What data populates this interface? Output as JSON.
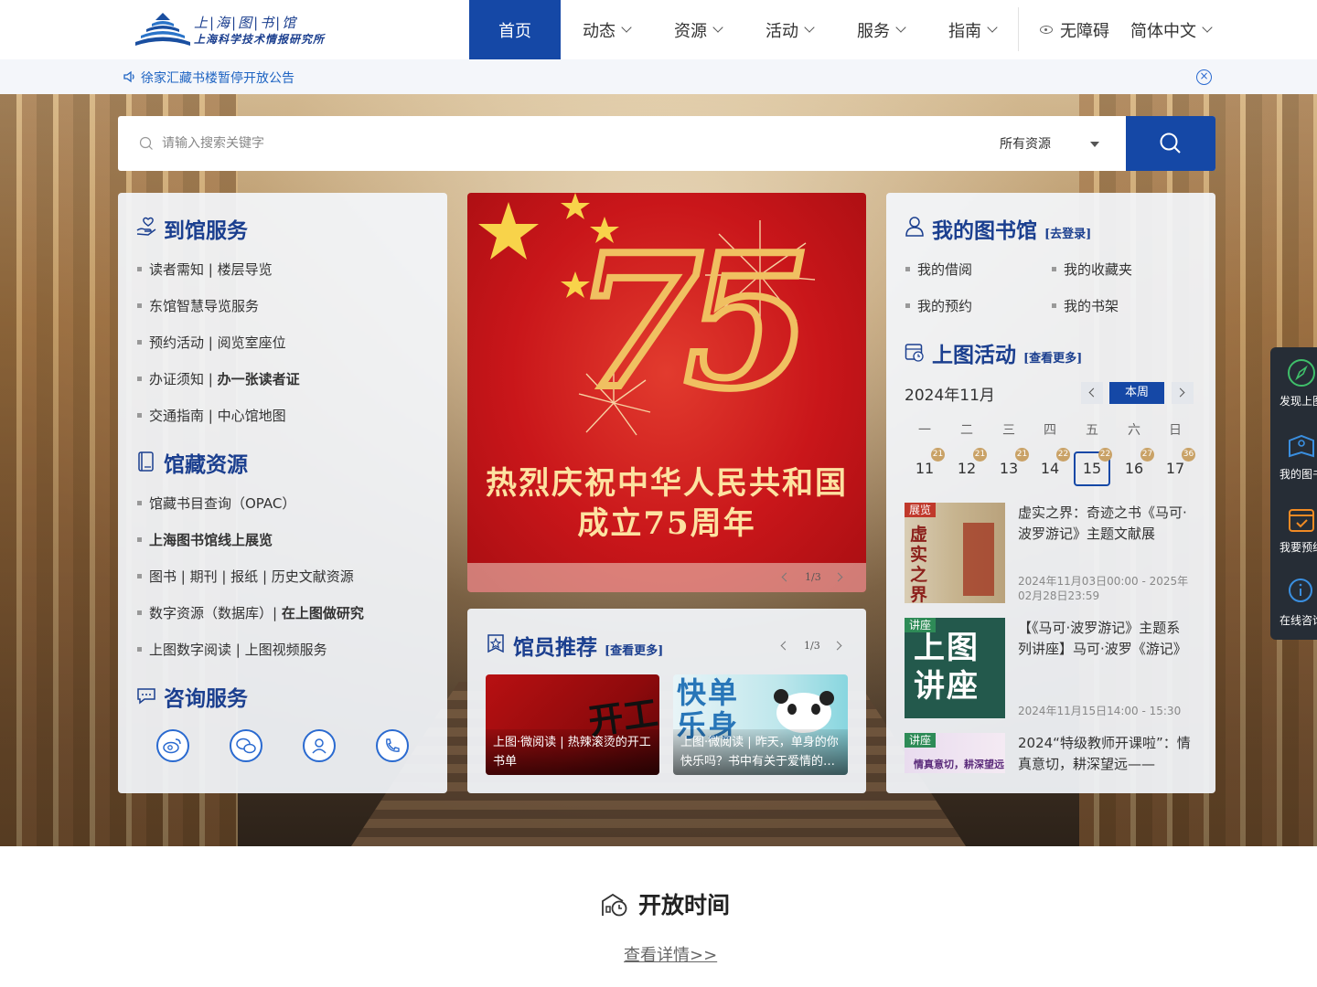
{
  "header": {
    "logo_line1": "上|海|图|书|馆",
    "logo_line2": "上海科学技术情报研究所",
    "nav": [
      {
        "label": "首页",
        "active": true
      },
      {
        "label": "动态",
        "active": false
      },
      {
        "label": "资源",
        "active": false
      },
      {
        "label": "活动",
        "active": false
      },
      {
        "label": "服务",
        "active": false
      },
      {
        "label": "指南",
        "active": false
      }
    ],
    "accessibility": "无障碍",
    "language": "简体中文"
  },
  "notice": {
    "text": "徐家汇藏书楼暂停开放公告"
  },
  "search": {
    "placeholder": "请输入搜索关键字",
    "scope": "所有资源"
  },
  "visit_service": {
    "title": "到馆服务",
    "items": [
      {
        "text": "读者需知 | 楼层导览"
      },
      {
        "text": "东馆智慧导览服务"
      },
      {
        "text": "预约活动 | 阅览室座位"
      },
      {
        "text": "办证须知 | ",
        "bold": "办一张读者证"
      },
      {
        "text": "交通指南 | 中心馆地图"
      }
    ]
  },
  "collection": {
    "title": "馆藏资源",
    "items": [
      {
        "text": "馆藏书目查询（OPAC）"
      },
      {
        "text": "",
        "bold": "上海图书馆线上展览"
      },
      {
        "text": "图书 | 期刊 | 报纸 | 历史文献资源"
      },
      {
        "text": "数字资源（数据库）| ",
        "bold": "在上图做研究"
      },
      {
        "text": "上图数字阅读 | 上图视频服务"
      }
    ]
  },
  "consult": {
    "title": "咨询服务",
    "icons": [
      "weibo-icon",
      "wechat-icon",
      "customer-service-icon",
      "phone-icon"
    ]
  },
  "banner": {
    "big_number": "75",
    "line1": "热烈庆祝中华人民共和国",
    "line2": "成立75周年",
    "pager": "1/3"
  },
  "recommend": {
    "title": "馆员推荐",
    "more": "[查看更多]",
    "pager": "1/3",
    "cards": [
      {
        "caption": "上图·微阅读 | 热辣滚烫的开工书单",
        "art_text": "开工"
      },
      {
        "caption": "上图·微阅读 | 昨天，单身的你快乐吗？书中有关于爱情的答案",
        "art_text": "快单乐身"
      }
    ]
  },
  "my_library": {
    "title": "我的图书馆",
    "login": "[去登录]",
    "items": [
      "我的借阅",
      "我的收藏夹",
      "我的预约",
      "我的书架"
    ]
  },
  "activities": {
    "title": "上图活动",
    "more": "[查看更多]",
    "month": "2024年11月",
    "this_week": "本周",
    "weekdays": [
      "一",
      "二",
      "三",
      "四",
      "五",
      "六",
      "日"
    ],
    "days": [
      {
        "day": "11",
        "count": "21",
        "today": false
      },
      {
        "day": "12",
        "count": "21",
        "today": false
      },
      {
        "day": "13",
        "count": "21",
        "today": false
      },
      {
        "day": "14",
        "count": "22",
        "today": false
      },
      {
        "day": "15",
        "count": "22",
        "today": true
      },
      {
        "day": "16",
        "count": "27",
        "today": false
      },
      {
        "day": "17",
        "count": "36",
        "today": false
      }
    ],
    "events": [
      {
        "tag": "展览",
        "tag_color": "#c0392b",
        "title": "虚实之界：奇迹之书《马可·波罗游记》主题文献展",
        "time": "2024年11月03日00:00 - 2025年02月28日23:59",
        "art_text": "虚实之界"
      },
      {
        "tag": "讲座",
        "tag_color": "#2e8b57",
        "title": "【《马可·波罗游记》主题系列讲座】马可·波罗《游记》",
        "time": "2024年11月15日14:00 - 15:30",
        "art_text": "上图讲座"
      },
      {
        "tag": "讲座",
        "tag_color": "#2e8b57",
        "title": "2024“特级教师开课啦”：情真意切，耕深望远——",
        "time": "",
        "art_text": "情真意切，耕深望远"
      }
    ]
  },
  "side_float": [
    {
      "label": "发现上图",
      "icon": "compass-icon"
    },
    {
      "label": "我的图书馆",
      "icon": "book-user-icon"
    },
    {
      "label": "我要预约",
      "icon": "calendar-icon"
    },
    {
      "label": "在线咨询",
      "icon": "chat-info-icon"
    }
  ],
  "opening": {
    "title": "开放时间",
    "link": "查看详情>>"
  },
  "colors": {
    "primary": "#1548a6",
    "title_blue": "#1b3f8f",
    "banner_red": "#c9161a",
    "badge_gold": "#c9a267"
  }
}
